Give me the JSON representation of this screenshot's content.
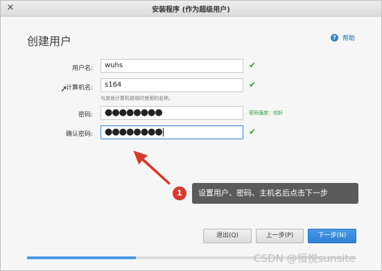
{
  "window": {
    "title": "安装程序 (作为超级用户)",
    "close_icon": "close-icon"
  },
  "page": {
    "title": "创建用户"
  },
  "help": {
    "label": "帮助",
    "icon": "help-icon"
  },
  "form": {
    "username": {
      "label": "用户名:",
      "value": "wuhs",
      "valid": true
    },
    "hostname": {
      "label": "计算机名:",
      "value": "s164",
      "hint": "与其他计算机联络时使用的名称。",
      "valid": true
    },
    "password": {
      "label": "密码:",
      "value": "●●●●●●●●",
      "strength": "密码强度：较好"
    },
    "confirm": {
      "label": "确认密码:",
      "value": "●●●●●●●●",
      "valid": true
    }
  },
  "annotation": {
    "badge": "1",
    "text": "设置用户、密码、主机名后点击下一步"
  },
  "buttons": {
    "quit": "退出(Q)",
    "back": "上一步(P)",
    "next": "下一步(N)"
  },
  "progress": {
    "fraction": 0.33
  },
  "watermark": "CSDN @恒悦sunsite",
  "colors": {
    "accent": "#2f7ed8",
    "check": "#2aa53a",
    "badge": "#d63a2e",
    "callout": "#5b5b5b"
  }
}
